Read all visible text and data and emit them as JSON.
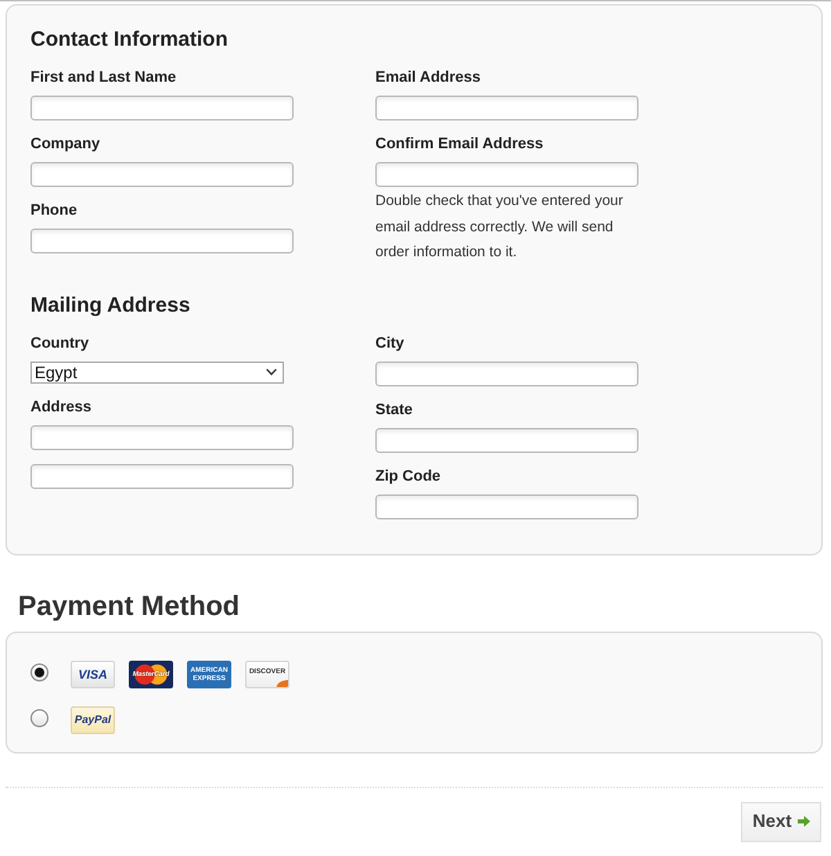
{
  "contact_information": {
    "title": "Contact Information",
    "left_column": [
      {
        "kind": "text",
        "label": "First and Last Name"
      },
      {
        "kind": "text",
        "label": "Company"
      },
      {
        "kind": "text",
        "label": "Phone"
      }
    ],
    "right_column": [
      {
        "kind": "text",
        "label": "Email Address"
      },
      {
        "kind": "text",
        "label": "Confirm Email Address",
        "note": "Double check that you've entered your email address correctly. We will send order information to it."
      }
    ]
  },
  "mailing_address": {
    "title": "Mailing Address",
    "left_column": [
      {
        "kind": "select",
        "label": "Country",
        "value": "Egypt"
      },
      {
        "kind": "text",
        "label": "Address"
      },
      {
        "kind": "text"
      }
    ],
    "right_column": [
      {
        "kind": "text",
        "label": "City"
      },
      {
        "kind": "text",
        "label": "State"
      },
      {
        "kind": "text",
        "label": "Zip Code"
      }
    ]
  },
  "payment_method": {
    "title": "Payment Method",
    "options": [
      {
        "selected": true,
        "logos": [
          {
            "kind": "visa",
            "label": "VISA"
          },
          {
            "kind": "mastercard",
            "label": "MasterCard"
          },
          {
            "kind": "amex",
            "label": "AMERICAN EXPRESS"
          },
          {
            "kind": "discover",
            "label": "DISCOVER"
          }
        ]
      },
      {
        "selected": false,
        "logos": [
          {
            "kind": "paypal",
            "label": "PayPal"
          }
        ]
      }
    ]
  },
  "next_button": {
    "label": "Next"
  }
}
